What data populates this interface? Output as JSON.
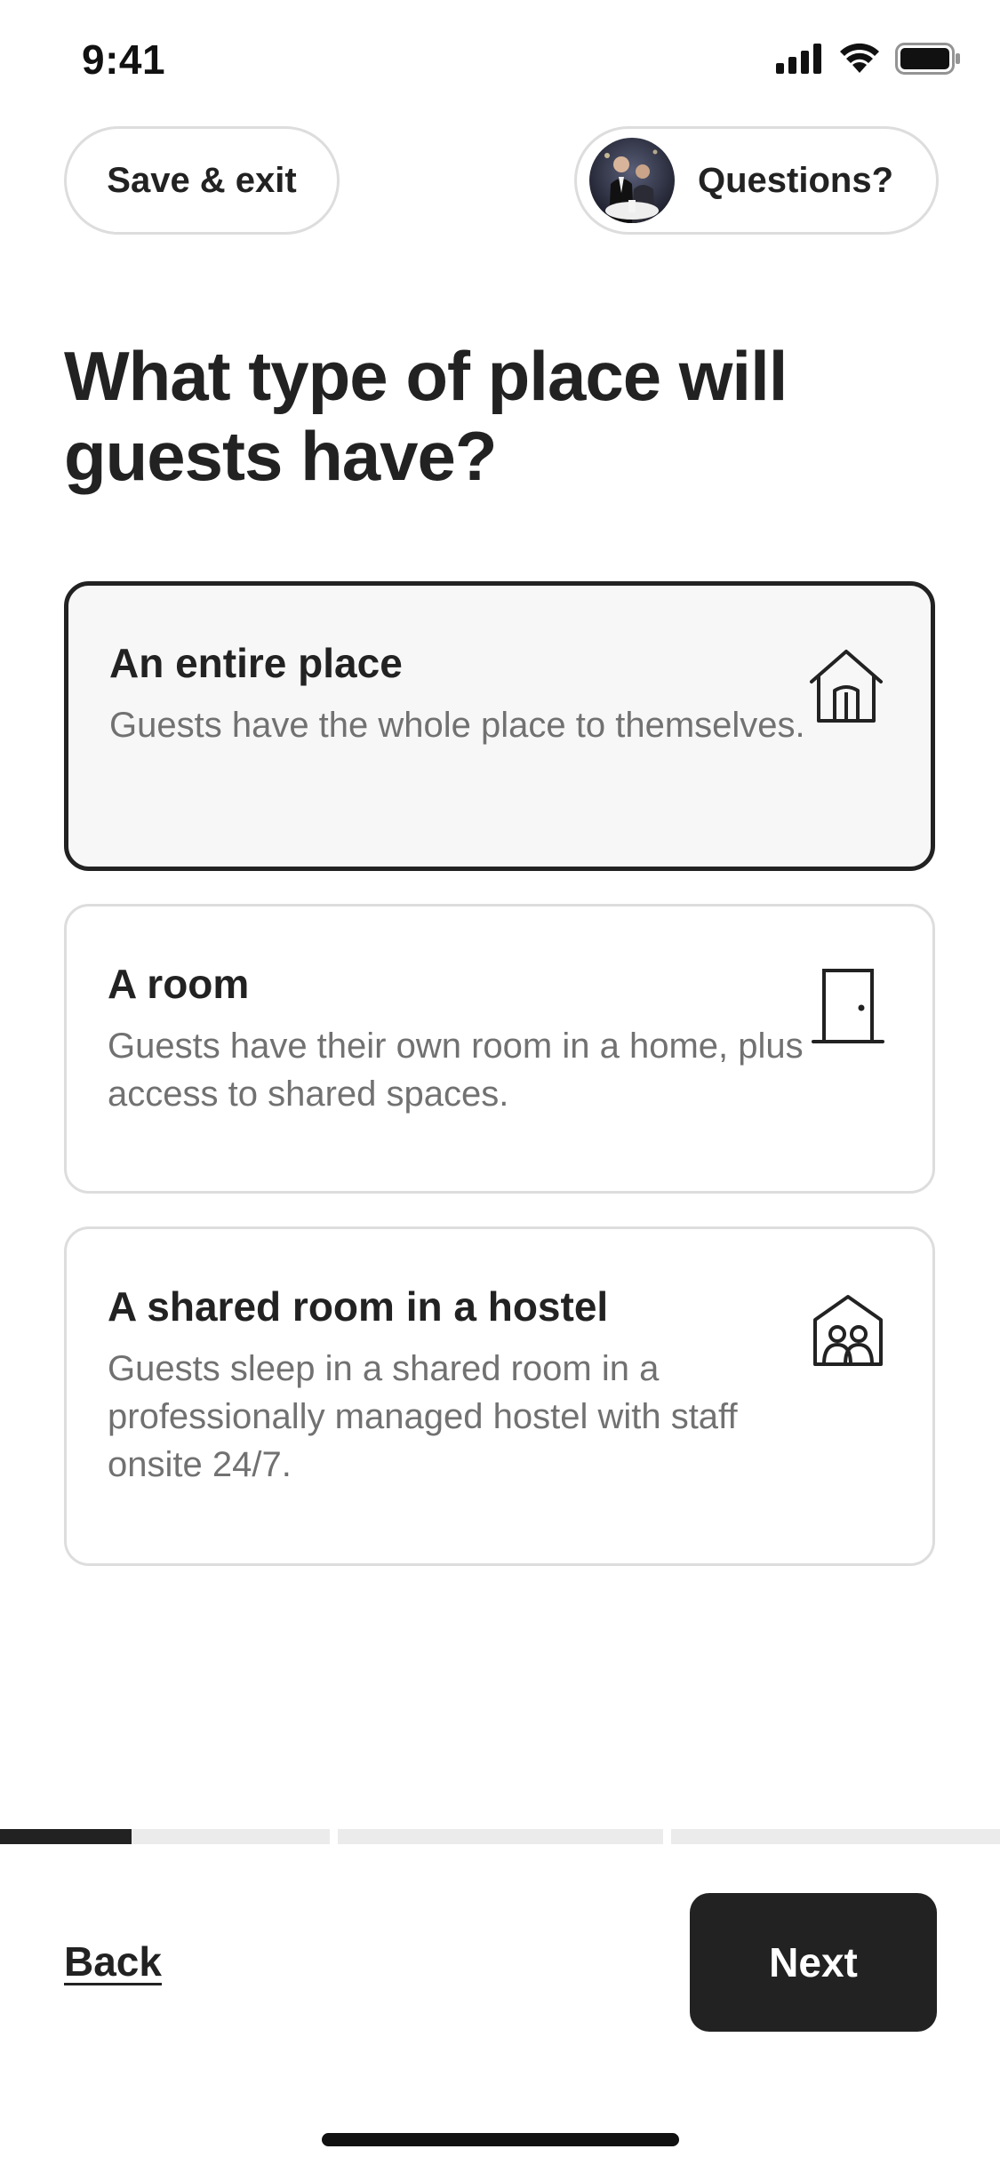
{
  "status_bar": {
    "time": "9:41"
  },
  "header": {
    "save_exit_label": "Save & exit",
    "questions_label": "Questions?"
  },
  "page": {
    "title": "What type of place will guests have?"
  },
  "options": [
    {
      "title": "An entire place",
      "description": "Guests have the whole place to themselves.",
      "icon": "house-icon",
      "selected": true
    },
    {
      "title": "A room",
      "description": "Guests have their own room in a home, plus access to shared spaces.",
      "icon": "door-icon",
      "selected": false
    },
    {
      "title": "A shared room in a hostel",
      "description": "Guests sleep in a shared room in a professionally managed hostel with staff onsite 24/7.",
      "icon": "shared-room-icon",
      "selected": false
    }
  ],
  "progress": {
    "steps_total": 3,
    "current_step": 1,
    "current_step_fraction": 0.4
  },
  "footer": {
    "back_label": "Back",
    "next_label": "Next"
  },
  "colors": {
    "text_primary": "#222222",
    "text_secondary": "#717171",
    "border": "#dddddd",
    "selected_bg": "#f7f7f7",
    "progress_track": "#ebebeb",
    "button_bg": "#222222"
  }
}
